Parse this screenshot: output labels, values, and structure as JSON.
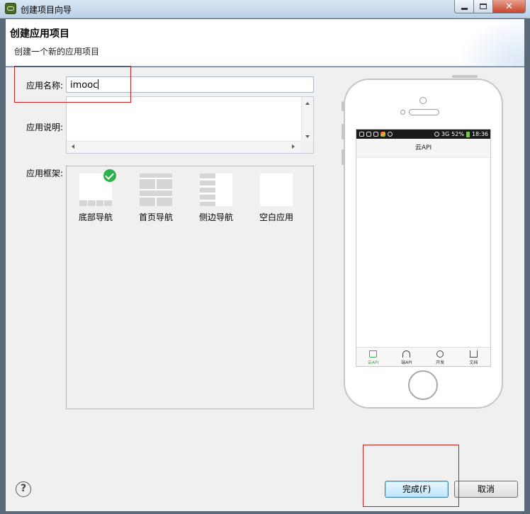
{
  "window": {
    "title": "创建项目向导",
    "close_glyph": "✕"
  },
  "header": {
    "title": "创建应用项目",
    "subtitle": "创建一个新的应用项目"
  },
  "form": {
    "name_label": "应用名称:",
    "name_value": "imooc",
    "desc_label": "应用说明:",
    "desc_value": "",
    "framework_label": "应用框架:",
    "frameworks": [
      {
        "label": "底部导航",
        "selected": true
      },
      {
        "label": "首页导航",
        "selected": false
      },
      {
        "label": "侧边导航",
        "selected": false
      },
      {
        "label": "空白应用",
        "selected": false
      }
    ]
  },
  "preview": {
    "time": "18:36",
    "battery": "52%",
    "signal": "3G",
    "app_title": "云API",
    "tabs": [
      {
        "label": "云API",
        "icon": "home-icon",
        "active": true
      },
      {
        "label": "端API",
        "icon": "gauge-icon",
        "active": false
      },
      {
        "label": "开发",
        "icon": "flower-icon",
        "active": false
      },
      {
        "label": "文档",
        "icon": "download-icon",
        "active": false
      }
    ]
  },
  "footer": {
    "help_glyph": "?",
    "finish_label": "完成(F)",
    "cancel_label": "取消"
  },
  "colors": {
    "annotation": "#c8201f",
    "check": "#2bb24c",
    "primary_button": "#bee6fd"
  }
}
